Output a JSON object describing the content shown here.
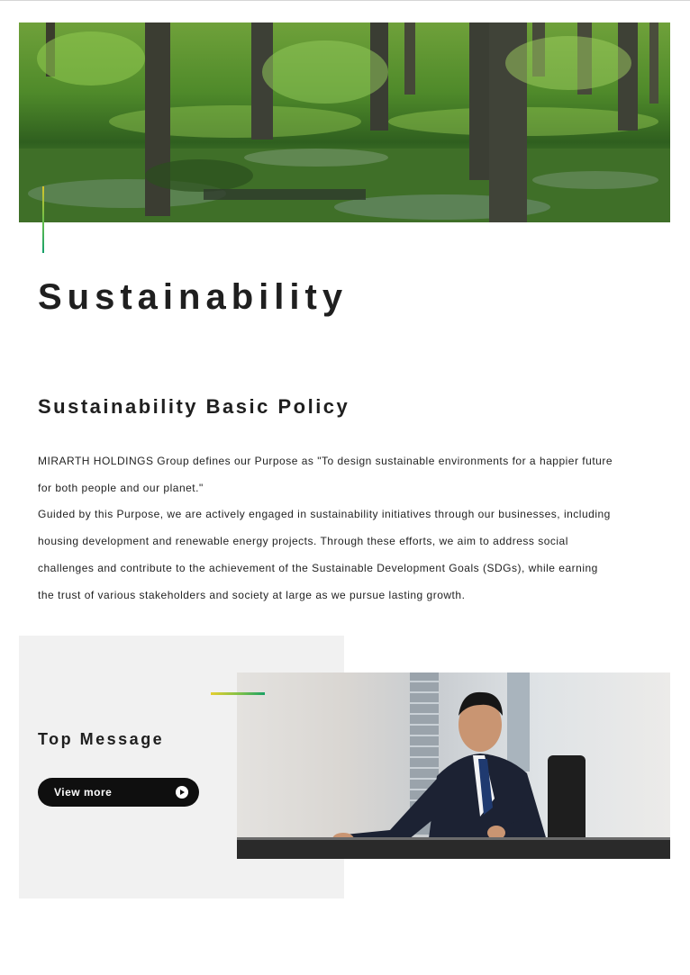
{
  "page": {
    "title": "Sustainability"
  },
  "hero": {
    "image": "forest-landscape"
  },
  "policy": {
    "heading": "Sustainability Basic Policy",
    "lines": [
      "MIRARTH HOLDINGS Group defines our Purpose as \"To design sustainable environments for a happier future",
      "for both people and our planet.\"",
      "Guided by this Purpose, we are actively engaged in sustainability initiatives through our businesses, including",
      "housing development and renewable energy projects. Through these efforts, we aim to address social",
      "challenges and contribute to the achievement of the Sustainable Development Goals (SDGs), while earning",
      "the trust of various stakeholders and society at large as we pursue lasting growth."
    ]
  },
  "top_message": {
    "title": "Top Message",
    "button_label": "View more",
    "button_icon": "arrow-circle-icon",
    "photo": "executive-portrait"
  },
  "colors": {
    "accent_yellow": "#e6cf2f",
    "accent_green": "#1aa164",
    "button_bg": "#0f0f0f",
    "panel_bg": "#f1f1f1"
  }
}
